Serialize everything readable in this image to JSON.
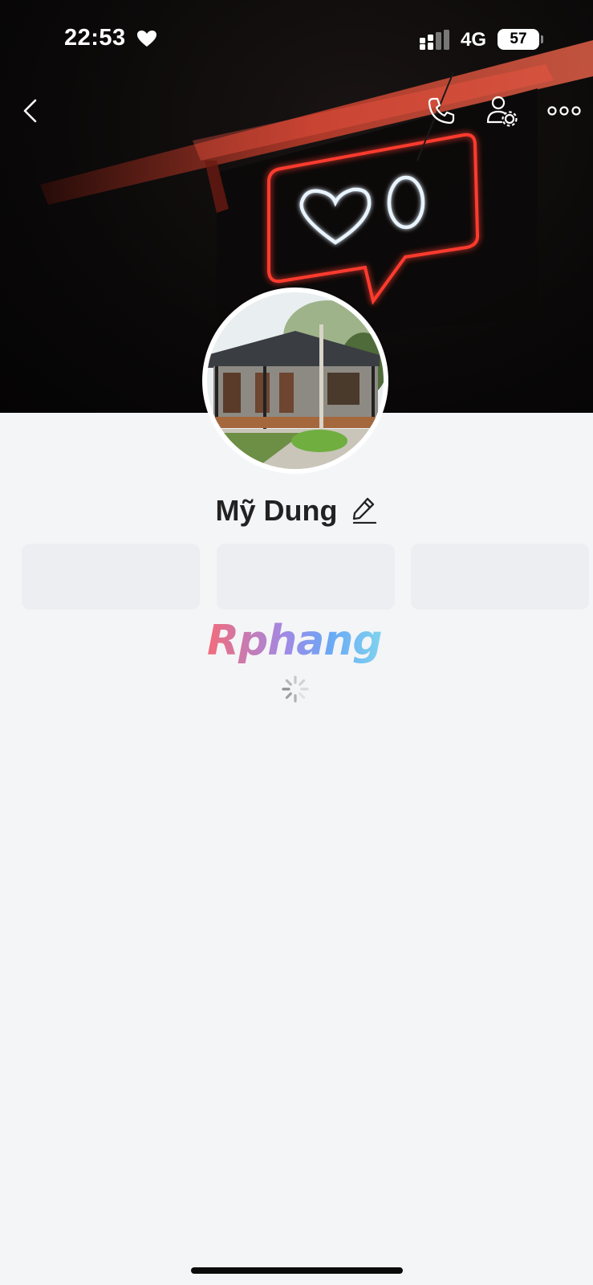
{
  "status_bar": {
    "time": "22:53",
    "network": "4G",
    "battery": "57"
  },
  "nav": {
    "icons": [
      "back-icon",
      "phone-icon",
      "user-settings-icon",
      "more-icon"
    ]
  },
  "profile": {
    "name": "Mỹ Dung"
  },
  "watermark": {
    "text": "Rphang"
  },
  "colors": {
    "background": "#f4f5f7",
    "neon_red": "#ff3b2f",
    "neon_white": "#e8f4ff",
    "skeleton": "#eceef1"
  }
}
